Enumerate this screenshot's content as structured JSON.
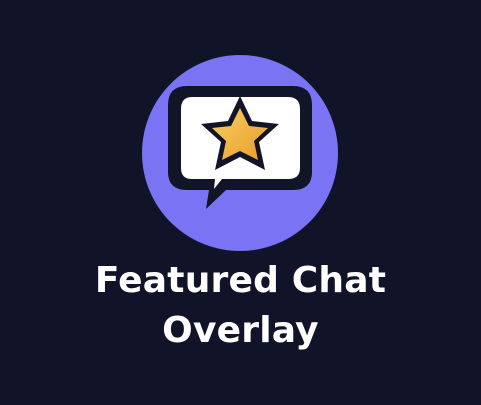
{
  "title": {
    "line1": "Featured Chat",
    "line2": "Overlay"
  },
  "icon": {
    "name": "chat-bubble-star-icon",
    "circle_color": "#7a73f3",
    "bubble_fill": "#ffffff",
    "bubble_outline": "#121427",
    "star_fill": "#f2b542",
    "star_outline": "#121427"
  },
  "background_color": "#111428"
}
